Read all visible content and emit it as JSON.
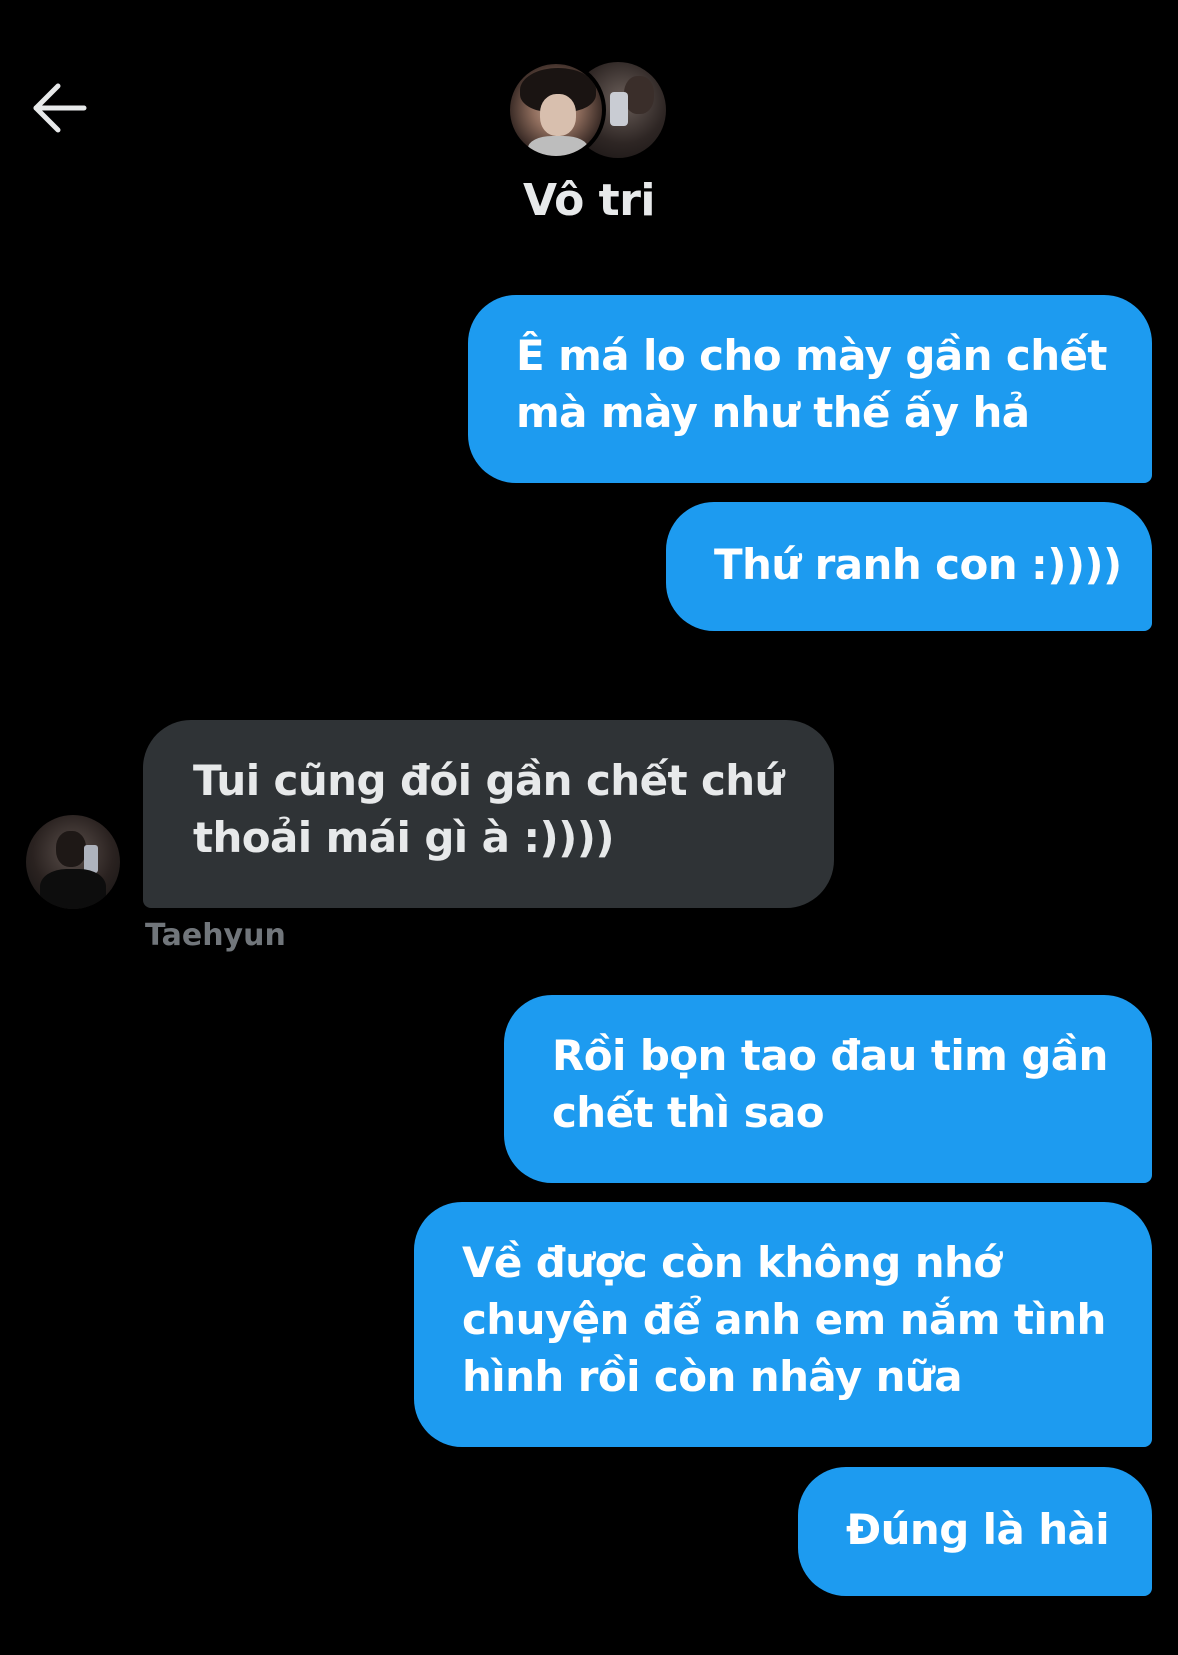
{
  "header": {
    "back_icon": "arrow-left-icon",
    "title": "Vô tri"
  },
  "messages": [
    {
      "side": "sent",
      "text": "Ê má lo cho mày gần chết\nmà mày như thế ấy hả"
    },
    {
      "side": "sent",
      "text": "Thứ ranh con :))))"
    },
    {
      "side": "received",
      "sender": "Taehyun",
      "text": "Tui cũng đói gần chết chứ\nthoải mái gì à :))))"
    },
    {
      "side": "sent",
      "text": "Rồi bọn tao đau tim gần\nchết thì sao"
    },
    {
      "side": "sent",
      "text": "Về được còn không nhớ\nchuyện để anh em nắm tình\nhình rồi còn nhây nữa"
    },
    {
      "side": "sent",
      "text": "Đúng là hài"
    }
  ],
  "colors": {
    "background": "#000000",
    "sent_bubble": "#1d9bf0",
    "received_bubble": "#2f3336",
    "sender_name": "#71767b"
  }
}
